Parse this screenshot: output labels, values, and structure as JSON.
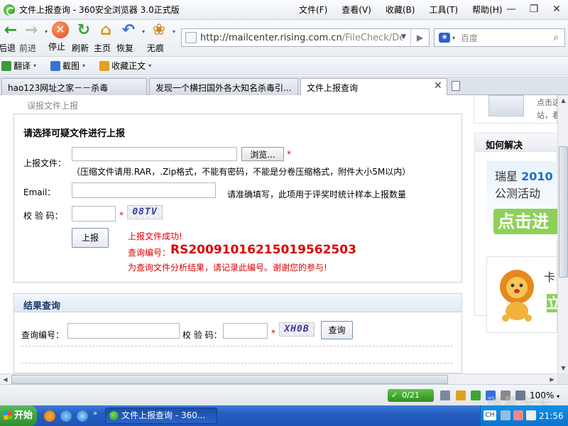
{
  "window": {
    "title": "文件上报查询 - 360安全浏览器 3.0正式版",
    "menu": [
      "文件(F)",
      "查看(V)",
      "收藏(B)",
      "工具(T)",
      "帮助(H)"
    ],
    "controls": {
      "minimize": "—",
      "restore": "❐",
      "close": "✕"
    }
  },
  "nav": {
    "back": "后退",
    "forward": "前进",
    "stop": "停止",
    "refresh": "刷新",
    "home": "主页",
    "restore": "恢复",
    "incognito": "无痕"
  },
  "address": {
    "url_domain": "http://mailcenter.rising.com.cn",
    "url_path": "/FileCheck/Default."
  },
  "search": {
    "placeholder": "百度"
  },
  "toolbar2": {
    "translate": "翻译",
    "screenshot": "截图",
    "favorites": "收藏正文"
  },
  "tabs": [
    {
      "label": "hao123网址之家－－杀毒"
    },
    {
      "label": "发现一个横扫国外各大知名杀毒引..."
    },
    {
      "label": "文件上报查询"
    }
  ],
  "page": {
    "breadcrumb": "误报文件上报",
    "upload": {
      "title": "请选择可疑文件进行上报",
      "file_label": "上报文件：",
      "browse": "浏览...",
      "file_hint": "（压缩文件请用.RAR，.Zip格式，不能有密码，不能是分卷压缩格式，附件大小5M以内）",
      "email_label": "Email：",
      "email_hint": "请准确填写，此项用于评奖时统计样本上报数量",
      "code_label": "校 验 码：",
      "captcha": "08TV",
      "submit": "上报",
      "success": "上报文件成功!",
      "query_label": "查询编号：",
      "query_code": "RS200910162150195625­03",
      "note": "为查询文件分析结果，请记录此编号。谢谢您的参与!"
    },
    "result": {
      "title": "结果查询",
      "id_label": "查询编号：",
      "code_label": "校 验 码：",
      "captcha": "XH0B",
      "query_button": "查询"
    },
    "sidebar": {
      "top_text_1": "点击这",
      "top_text_2": "站，看",
      "box_title": "如何解决",
      "promo_brand": "瑞星",
      "promo_year": "2010",
      "promo_sub": "公测活动",
      "promo_cta": "点击进",
      "promo2_text": "卡",
      "promo2_cta": "立"
    }
  },
  "status": {
    "counter": "0/21",
    "zoom": "100%"
  },
  "taskbar": {
    "start": "开始",
    "task": "文件上报查询 - 360...",
    "ime": "CH",
    "clock": "21:56"
  },
  "watermark": "瑞星卡卡"
}
